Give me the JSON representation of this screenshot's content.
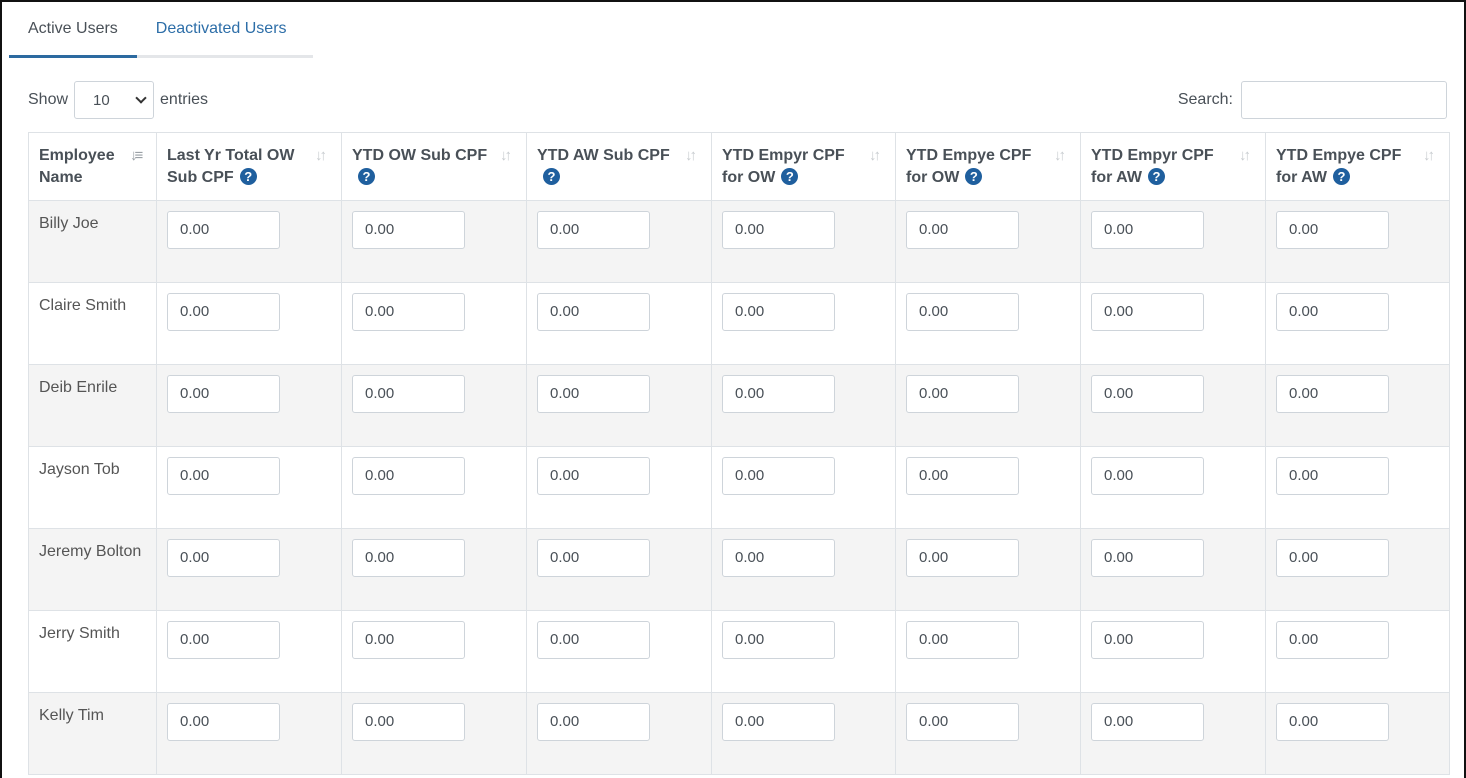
{
  "tabs": [
    {
      "label": "Active Users",
      "active": true
    },
    {
      "label": "Deactivated Users",
      "active": false
    }
  ],
  "length_control": {
    "show_label": "Show",
    "selected": "10",
    "entries_label": "entries"
  },
  "search": {
    "label": "Search:",
    "value": ""
  },
  "table": {
    "columns": [
      {
        "label": "Employee Name",
        "help": false,
        "sort": "asc"
      },
      {
        "label": "Last Yr Total OW Sub CPF",
        "help": true,
        "sort": "none"
      },
      {
        "label": "YTD OW Sub CPF",
        "help": true,
        "sort": "none"
      },
      {
        "label": "YTD AW Sub CPF",
        "help": true,
        "sort": "none"
      },
      {
        "label": "YTD Empyr CPF for OW",
        "help": true,
        "sort": "none"
      },
      {
        "label": "YTD Empye CPF for OW",
        "help": true,
        "sort": "none"
      },
      {
        "label": "YTD Empyr CPF for AW",
        "help": true,
        "sort": "none"
      },
      {
        "label": "YTD Empye CPF for AW",
        "help": true,
        "sort": "none"
      }
    ],
    "rows": [
      {
        "name": "Billy Joe",
        "values": [
          "0.00",
          "0.00",
          "0.00",
          "0.00",
          "0.00",
          "0.00",
          "0.00"
        ]
      },
      {
        "name": "Claire Smith",
        "values": [
          "0.00",
          "0.00",
          "0.00",
          "0.00",
          "0.00",
          "0.00",
          "0.00"
        ]
      },
      {
        "name": "Deib Enrile",
        "values": [
          "0.00",
          "0.00",
          "0.00",
          "0.00",
          "0.00",
          "0.00",
          "0.00"
        ]
      },
      {
        "name": "Jayson Tob",
        "values": [
          "0.00",
          "0.00",
          "0.00",
          "0.00",
          "0.00",
          "0.00",
          "0.00"
        ]
      },
      {
        "name": "Jeremy Bolton",
        "values": [
          "0.00",
          "0.00",
          "0.00",
          "0.00",
          "0.00",
          "0.00",
          "0.00"
        ]
      },
      {
        "name": "Jerry Smith",
        "values": [
          "0.00",
          "0.00",
          "0.00",
          "0.00",
          "0.00",
          "0.00",
          "0.00"
        ]
      },
      {
        "name": "Kelly Tim",
        "values": [
          "0.00",
          "0.00",
          "0.00",
          "0.00",
          "0.00",
          "0.00",
          "0.00"
        ]
      }
    ]
  },
  "icons": {
    "help": "question-circle-icon",
    "sort": "sort-arrows-icon",
    "select": "chevron-down-icon"
  },
  "colors": {
    "tab_accent": "#2c6aa0",
    "link": "#2d6ea8",
    "help_icon": "#1f5f9e",
    "stripe": "#f4f4f4"
  }
}
